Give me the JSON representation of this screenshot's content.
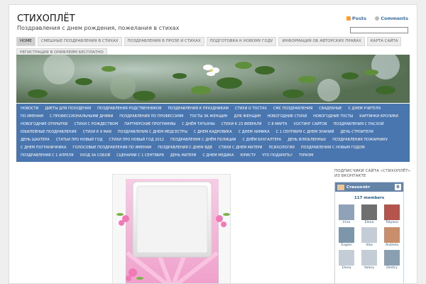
{
  "site": {
    "title": "СТИХОПЛЁТ",
    "description": "Поздравления с днем рождения, пожелания в стихах"
  },
  "feeds": {
    "posts": "Posts",
    "comments": "Comments"
  },
  "top_nav": [
    "Home",
    "Смешные поздравления в стихах",
    "Поздравления в прозе и стихах",
    "Подготовка к новому году",
    "Информация об авторских правах",
    "Карта сайта",
    "Регистрация в Орифлейм бесплатно"
  ],
  "category_nav": [
    "Новости",
    "Диеты для похудения",
    "Поздравления родственников",
    "Поздравления к праздникам",
    "Стихи о тостах",
    "СМС поздравления",
    "Свадебные",
    "С днем учителя",
    "По именам",
    "С профессиональными днями",
    "Поздравления по профессиям",
    "Тосты за женщин",
    "Для женщин",
    "Новогодние стихи",
    "Новогодние тосты",
    "Картинки кролики",
    "Новогодние открытки",
    "Стихи с Рождеством",
    "Партнерские программы",
    "С днём Татьяны",
    "Стихи к 23 февраля",
    "С 8 Марта",
    "Хостинг сайтов",
    "Поздравления с Пасхой",
    "Юбилейные поздравления",
    "Стихи к 9 мая",
    "Поздравления с днем медсестры",
    "С днем кадровика",
    "С днем химика",
    "С 1 сентября с днем знаний",
    "День строителя",
    "День шахтера",
    "Статьи про Новый год",
    "Стихи про Новый год 2012",
    "Поздравления с днём полиции",
    "С днём бухгалтера",
    "День влюбленных",
    "Поздравления пожарнику",
    "С днем пограничника",
    "Голосовые поздравления по именам",
    "Поздравления с днем ВДВ",
    "Стихи с днем матери",
    "Психология",
    "Поздравления с Новым годом",
    "Поздравления с 1 апреля",
    "Уход за собой",
    "Сценарии с 1 сентября",
    "День матери",
    "С днем медика",
    "Юристу",
    "Что подарить?",
    "Туризм"
  ],
  "sidebar": {
    "widget_title": "ПОДПИСЧИКИ САЙТА «СТИХОПЛЁТ» ИЗ ВКОНТАКТЕ",
    "group_name": "Стихоплёт",
    "vk_logo": "B",
    "members_count": "117 members",
    "members": [
      "Irina",
      "Elena",
      "Tatyana",
      "Evgeni",
      "Vika",
      "Anzhela",
      "Elena",
      "Valery",
      "Dmitry"
    ]
  },
  "colors": {
    "nav_blue": "#4a76b0",
    "link_blue": "#3a6ea8",
    "vk_blue": "#6383a8"
  }
}
